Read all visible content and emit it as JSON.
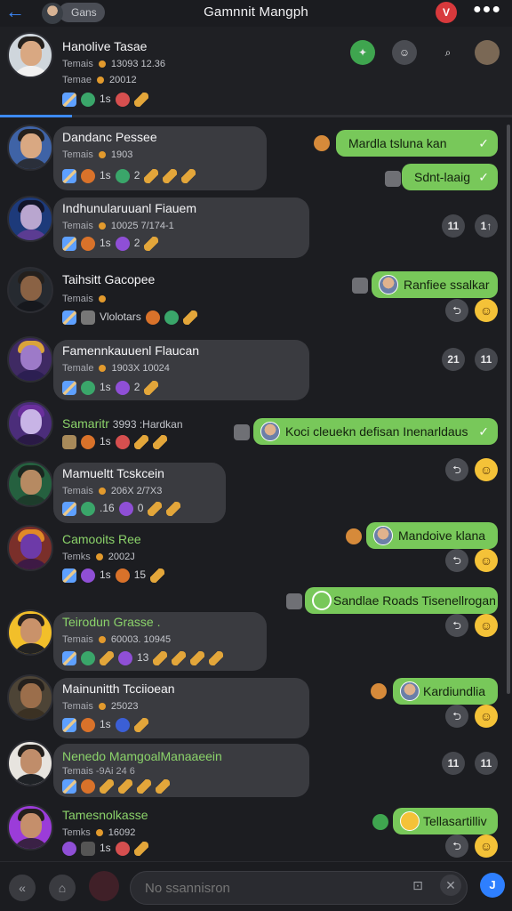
{
  "app": {
    "title": "Gamnnit Mangph",
    "pill_label": "Gans",
    "badge_label": "V",
    "more_label": "●●●"
  },
  "pinned": {
    "name": "Hanolive Tasae",
    "stat1_label": "Temais",
    "stat1_value": "13093 12.36",
    "stat2_label": "Temae",
    "stat2_value": "20012",
    "icons_text": "1s",
    "progress_fraction": 0.14
  },
  "rows": [
    {
      "name": "Dandanc Pessee",
      "stat_label": "Temais",
      "stat_value": "1903",
      "icons_text": "1s",
      "icons_num": "2",
      "name_color": "white"
    },
    {
      "name": "Indhunularuuanl Fiauem",
      "stat_label": "Temais",
      "stat_value": "10025 7/174-1",
      "icons_text": "1s",
      "icons_num": "2",
      "name_color": "white"
    },
    {
      "name": "Taihsitt Gacopee",
      "stat_label": "Temais",
      "stat_value": "",
      "icons_text": "Vlolotars",
      "icons_num": "",
      "name_color": "white"
    },
    {
      "name": "Famennkauuenl Flaucan",
      "stat_label": "Temale",
      "stat_value": "1903X 10024",
      "icons_text": "1s",
      "icons_num": "2",
      "name_color": "white"
    },
    {
      "name": "Samaritr",
      "stat_label": "",
      "stat_value": "3993 :Hardkan",
      "icons_text": "1s",
      "icons_num": "",
      "name_color": "green"
    },
    {
      "name": "Mamueltt Tcskcein",
      "stat_label": "Temais",
      "stat_value": "206X 2/7X3",
      "icons_text": ".16",
      "icons_num": "0",
      "name_color": "white"
    },
    {
      "name": "Camooits Ree",
      "stat_label": "Temks",
      "stat_value": "2002J",
      "icons_text": "1s",
      "icons_num": "15",
      "name_color": "green"
    },
    {
      "name": "Teirodun Grasse .",
      "stat_label": "Temais",
      "stat_value": "60003. 10945",
      "icons_text": "",
      "icons_num": "13",
      "name_color": "green"
    },
    {
      "name": "Mainunitth Tcciioean",
      "stat_label": "Temais",
      "stat_value": "25023",
      "icons_text": "1s",
      "icons_num": "",
      "name_color": "white"
    },
    {
      "name": "Nenedo MamgoalManaaeein",
      "stat_label": "Temais -9Ai 24 6",
      "stat_value": "",
      "icons_text": "",
      "icons_num": "",
      "name_color": "green"
    },
    {
      "name": "Tamesnolkasse",
      "stat_label": "Temks",
      "stat_value": "16092",
      "icons_text": "",
      "icons_num": "",
      "name_color": "green"
    }
  ],
  "bubbles": [
    {
      "text": "Mardla tsluna kan"
    },
    {
      "text": "Sdnt-laaig"
    },
    {
      "text": "Ranfiee ssalkar"
    },
    {
      "text": "Koci cleuekn defisan Inenarldaus"
    },
    {
      "text": "Mandoive klana"
    },
    {
      "text": "Sandlae Roads Tisenellrogan"
    },
    {
      "text": "Kardiundlia"
    },
    {
      "text": "Tellasartilliv"
    }
  ],
  "reactions": {
    "count_a": "11",
    "count_b": "1↑",
    "count_c": "21",
    "count_d": "11",
    "count_e": "11",
    "count_f": "11"
  },
  "composer": {
    "placeholder": "No ssannisron",
    "send_label": "J"
  },
  "colors": {
    "accent": "#3d8bff",
    "bubble": "#78c85a",
    "card": "#3a3b40",
    "background": "#1c1d21"
  }
}
